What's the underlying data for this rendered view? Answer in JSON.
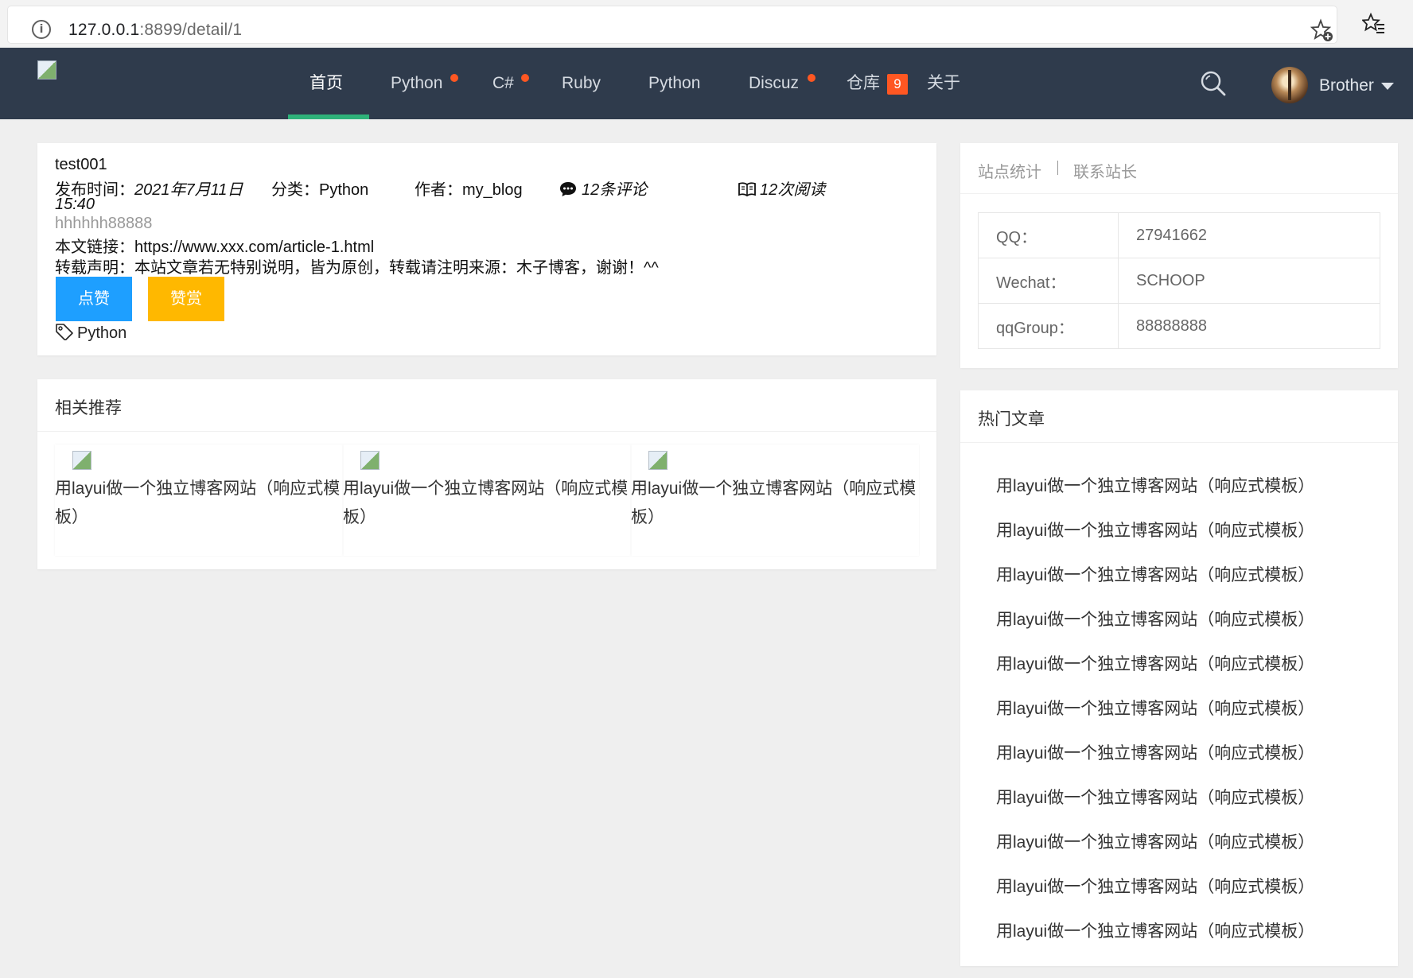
{
  "browser": {
    "url_host": "127.0.0.1",
    "url_rest": ":8899/detail/1"
  },
  "nav": {
    "items": [
      "首页",
      "Python",
      "C#",
      "Ruby",
      "Python",
      "Discuz",
      "仓库",
      "关于"
    ],
    "badge_count": "9",
    "user": "Brother"
  },
  "article": {
    "title": "test001",
    "publish_label": "发布时间：",
    "publish_date": "2021年7月11日",
    "publish_time": "15:40",
    "category_label": "分类：",
    "category": "Python",
    "author_label": "作者：",
    "author": "my_blog",
    "comments": "12条评论",
    "reads": "12次阅读",
    "desc": "hhhhhh88888",
    "link_label": "本文链接：",
    "link": "https://www.xxx.com/article-1.html",
    "notice": "转载声明：本站文章若无特别说明，皆为原创，转载请注明来源：木子博客，谢谢！^^",
    "like_button": "点赞",
    "reward_button": "赞赏",
    "tag": "Python"
  },
  "related": {
    "title": "相关推荐",
    "items": [
      "用layui做一个独立博客网站（响应式模板）",
      "用layui做一个独立博客网站（响应式模板）",
      "用layui做一个独立博客网站（响应式模板）"
    ]
  },
  "stats": {
    "tab1": "站点统计",
    "tab2": "联系站长",
    "rows": [
      {
        "label": "QQ：",
        "value": "27941662"
      },
      {
        "label": "Wechat：",
        "value": "SCHOOP"
      },
      {
        "label": "qqGroup：",
        "value": "88888888"
      }
    ]
  },
  "hot": {
    "title": "热门文章",
    "items": [
      "用layui做一个独立博客网站（响应式模板）",
      "用layui做一个独立博客网站（响应式模板）",
      "用layui做一个独立博客网站（响应式模板）",
      "用layui做一个独立博客网站（响应式模板）",
      "用layui做一个独立博客网站（响应式模板）",
      "用layui做一个独立博客网站（响应式模板）",
      "用layui做一个独立博客网站（响应式模板）",
      "用layui做一个独立博客网站（响应式模板）",
      "用layui做一个独立博客网站（响应式模板）",
      "用layui做一个独立博客网站（响应式模板）",
      "用layui做一个独立博客网站（响应式模板）"
    ]
  },
  "colors": {
    "header_bg": "#2f3b4c",
    "active_underline": "#2fb27a",
    "dot": "#ff5722",
    "like": "#1e9fff",
    "reward": "#ffb800"
  }
}
